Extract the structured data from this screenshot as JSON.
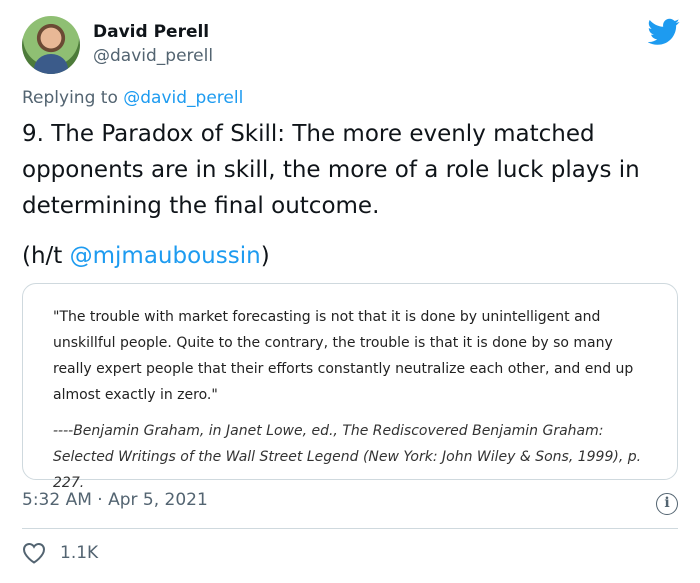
{
  "author": {
    "name": "David Perell",
    "handle": "@david_perell"
  },
  "reply": {
    "prefix": "Replying to ",
    "to": "@david_perell"
  },
  "tweet": {
    "text": "9. The Paradox of Skill: The more evenly matched opponents are in skill, the more of a role luck plays in determining the final outcome.",
    "ht_prefix": "(h/t ",
    "ht_mention": "@mjmauboussin",
    "ht_suffix": ")"
  },
  "quote": {
    "body": "\"The trouble with market forecasting is not that it is done by unintelligent and unskillful people. Quite to the contrary, the trouble is that it is done by so many really expert people that their efforts constantly neutralize each other, and end up almost exactly in zero.\"",
    "citation": "----Benjamin Graham, in Janet Lowe, ed., The Rediscovered Benjamin Graham: Selected Writings of the Wall Street Legend (New York: John Wiley & Sons, 1999), p. 227."
  },
  "meta": {
    "timestamp": "5:32 AM · Apr 5, 2021",
    "likes": "1.1K"
  },
  "colors": {
    "accent": "#1d9bf0",
    "secondary_text": "#536471"
  },
  "icons": {
    "brand": "twitter-bird-icon",
    "info": "info-icon",
    "like": "heart-icon"
  }
}
